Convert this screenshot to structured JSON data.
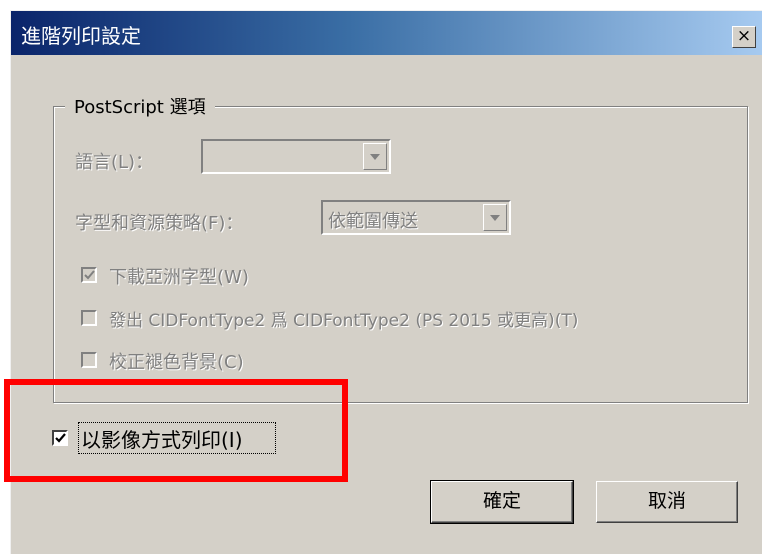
{
  "window": {
    "title": "進階列印設定",
    "close_label": "×"
  },
  "postscript": {
    "group_label": "PostScript 選項",
    "language_label": "語言(L)：",
    "language_value": "",
    "font_policy_label": "字型和資源策略(F)：",
    "font_policy_value": "依範圍傳送",
    "download_asian_fonts": {
      "label": "下載亞洲字型(W)",
      "checked": true,
      "enabled": false
    },
    "emit_cidfonttype2": {
      "label": "發出 CIDFontType2 爲 CIDFontType2 (PS 2015 或更高)(T)",
      "checked": false,
      "enabled": false
    },
    "correct_background": {
      "label": "校正褪色背景(C)",
      "checked": false,
      "enabled": false
    }
  },
  "print_as_image": {
    "label": "以影像方式列印(I)",
    "checked": true,
    "enabled": true
  },
  "buttons": {
    "ok": "確定",
    "cancel": "取消"
  },
  "colors": {
    "highlight_frame": "#ff0000",
    "title_gradient_start": "#0a246a",
    "dialog_bg": "#d4d0c8"
  }
}
